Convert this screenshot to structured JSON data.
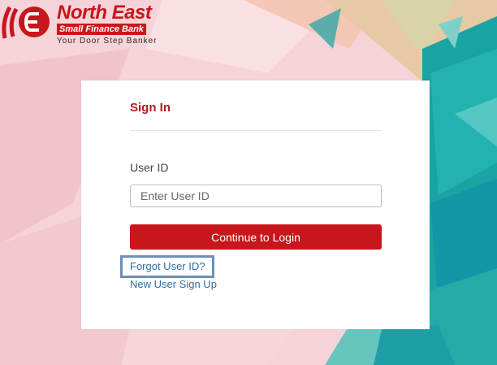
{
  "brand": {
    "name": "North East",
    "subtitle": "Small Finance Bank",
    "tagline": "Your Door Step Banker",
    "color": "#c8161d"
  },
  "login": {
    "title": "Sign In",
    "userid_label": "User ID",
    "userid_placeholder": "Enter User ID",
    "userid_value": "",
    "continue_label": "Continue to Login",
    "forgot_label": "Forgot User ID?",
    "signup_label": "New User Sign Up"
  },
  "colors": {
    "accent": "#c8161d",
    "link": "#2d6ea8",
    "highlight_border": "#6f8fb8",
    "background_pink": "#f6d3d8",
    "background_teal": "#1aa3a3"
  }
}
